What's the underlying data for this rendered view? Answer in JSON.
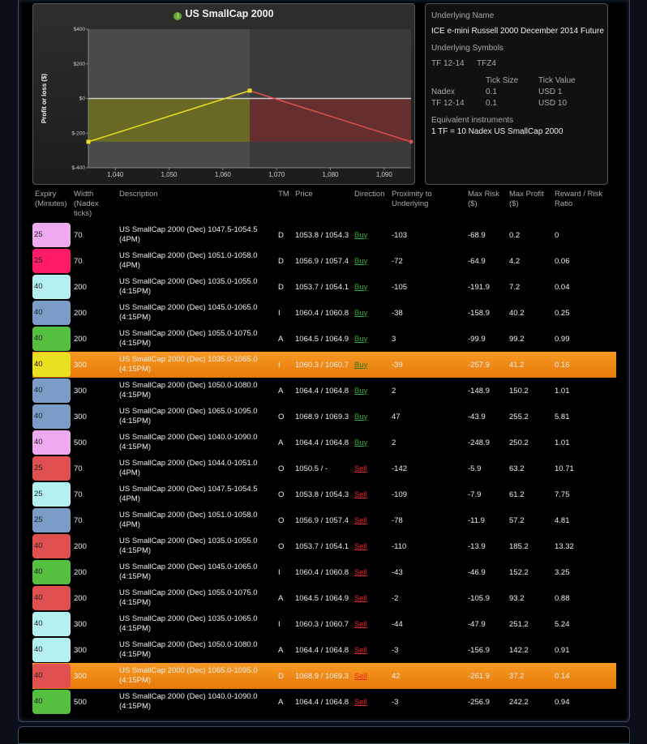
{
  "chart_data": {
    "type": "line",
    "title": "US SmallCap 2000",
    "xlabel": "",
    "ylabel": "Profit or loss ($)",
    "xlim": [
      1035,
      1095
    ],
    "ylim": [
      -400,
      400
    ],
    "x_ticks": [
      "1,040",
      "1,050",
      "1,060",
      "1,070",
      "1,080",
      "1,090"
    ],
    "y_ticks": [
      "$400",
      "$200",
      "$0",
      "$-200",
      "$-400"
    ],
    "grid": false,
    "series": [
      {
        "color": "#e8e020",
        "points": [
          [
            1035,
            -250
          ],
          [
            1065,
            45
          ]
        ]
      },
      {
        "color": "#e05050",
        "points": [
          [
            1065,
            45
          ],
          [
            1095,
            -250
          ]
        ]
      }
    ]
  },
  "info": {
    "underlying_name_label": "Underlying Name",
    "underlying_name": "ICE e-mini Russell 2000 December 2014 Future",
    "underlying_symbols_label": "Underlying Symbols",
    "symbol1": "TF 12-14",
    "symbol2": "TFZ4",
    "tick_size_label": "Tick Size",
    "tick_value_label": "Tick Value",
    "rows": [
      {
        "name": "Nadex",
        "tick_size": "0.1",
        "tick_value": "USD 1"
      },
      {
        "name": "TF 12-14",
        "tick_size": "0.1",
        "tick_value": "USD 10"
      }
    ],
    "equiv_label": "Equivalent instruments",
    "equiv_value": "1 TF = 10 Nadex US SmallCap 2000"
  },
  "table": {
    "headers": {
      "expiry": "Expiry\n(Minutes)",
      "width": "Width\n(Nadex\nticks)",
      "description": "Description",
      "tm": "TM",
      "price": "Price",
      "direction": "Direction",
      "proximity": "Proximity to\nUnderlying",
      "max_risk": "Max Risk\n($)",
      "max_profit": "Max Profit\n($)",
      "reward_risk": "Reward / Risk\nRatio"
    },
    "rows": [
      {
        "expiry": "25",
        "color": "#eeaaee",
        "width": "70",
        "desc": "US SmallCap 2000 (Dec) 1047.5-1054.5 (4PM)",
        "tm": "D",
        "price": "1053.8 / 1054.3",
        "dir": "Buy",
        "prox": "-103",
        "risk": "-68.9",
        "profit": "0.2",
        "ratio": "0",
        "hl": false
      },
      {
        "expiry": "25",
        "color": "#ff1a6a",
        "width": "70",
        "desc": "US SmallCap 2000 (Dec) 1051.0-1058.0 (4PM)",
        "tm": "D",
        "price": "1056.9 / 1057.4",
        "dir": "Buy",
        "prox": "-72",
        "risk": "-64.9",
        "profit": "4.2",
        "ratio": "0.06",
        "hl": false
      },
      {
        "expiry": "40",
        "color": "#b4f0f0",
        "width": "200",
        "desc": "US SmallCap 2000 (Dec) 1035.0-1055.0 (4:15PM)",
        "tm": "D",
        "price": "1053.7 / 1054.1",
        "dir": "Buy",
        "prox": "-105",
        "risk": "-191.9",
        "profit": "7.2",
        "ratio": "0.04",
        "hl": false
      },
      {
        "expiry": "40",
        "color": "#7a9cc6",
        "width": "200",
        "desc": "US SmallCap 2000 (Dec) 1045.0-1065.0 (4:15PM)",
        "tm": "I",
        "price": "1060.4 / 1060.8",
        "dir": "Buy",
        "prox": "-38",
        "risk": "-158.9",
        "profit": "40.2",
        "ratio": "0.25",
        "hl": false
      },
      {
        "expiry": "40",
        "color": "#55c040",
        "width": "200",
        "desc": "US SmallCap 2000 (Dec) 1055.0-1075.0 (4:15PM)",
        "tm": "A",
        "price": "1064.5 / 1064.9",
        "dir": "Buy",
        "prox": "3",
        "risk": "-99.9",
        "profit": "99.2",
        "ratio": "0.99",
        "hl": false
      },
      {
        "expiry": "40",
        "color": "#e8e020",
        "width": "300",
        "desc": "US SmallCap 2000 (Dec) 1035.0-1065.0 (4:15PM)",
        "tm": "I",
        "price": "1060.3 / 1060.7",
        "dir": "Buy",
        "prox": "-39",
        "risk": "-257.9",
        "profit": "41.2",
        "ratio": "0.16",
        "hl": true
      },
      {
        "expiry": "40",
        "color": "#7a9cc6",
        "width": "300",
        "desc": "US SmallCap 2000 (Dec) 1050.0-1080.0 (4:15PM)",
        "tm": "A",
        "price": "1064.4 / 1064.8",
        "dir": "Buy",
        "prox": "2",
        "risk": "-148.9",
        "profit": "150.2",
        "ratio": "1.01",
        "hl": false
      },
      {
        "expiry": "40",
        "color": "#7a9cc6",
        "width": "300",
        "desc": "US SmallCap 2000 (Dec) 1065.0-1095.0 (4:15PM)",
        "tm": "O",
        "price": "1068.9 / 1069.3",
        "dir": "Buy",
        "prox": "47",
        "risk": "-43.9",
        "profit": "255.2",
        "ratio": "5.81",
        "hl": false
      },
      {
        "expiry": "40",
        "color": "#eeaaee",
        "width": "500",
        "desc": "US SmallCap 2000 (Dec) 1040.0-1090.0 (4:15PM)",
        "tm": "A",
        "price": "1064.4 / 1064.8",
        "dir": "Buy",
        "prox": "2",
        "risk": "-248.9",
        "profit": "250.2",
        "ratio": "1.01",
        "hl": false
      },
      {
        "expiry": "25",
        "color": "#e05050",
        "width": "70",
        "desc": "US SmallCap 2000 (Dec) 1044.0-1051.0 (4PM)",
        "tm": "O",
        "price": "1050.5 / -",
        "dir": "Sell",
        "prox": "-142",
        "risk": "-5.9",
        "profit": "63.2",
        "ratio": "10.71",
        "hl": false
      },
      {
        "expiry": "25",
        "color": "#b4f0f0",
        "width": "70",
        "desc": "US SmallCap 2000 (Dec) 1047.5-1054.5 (4PM)",
        "tm": "O",
        "price": "1053.8 / 1054.3",
        "dir": "Sell",
        "prox": "-109",
        "risk": "-7.9",
        "profit": "61.2",
        "ratio": "7.75",
        "hl": false
      },
      {
        "expiry": "25",
        "color": "#7a9cc6",
        "width": "70",
        "desc": "US SmallCap 2000 (Dec) 1051.0-1058.0 (4PM)",
        "tm": "O",
        "price": "1056.9 / 1057.4",
        "dir": "Sell",
        "prox": "-78",
        "risk": "-11.9",
        "profit": "57.2",
        "ratio": "4.81",
        "hl": false
      },
      {
        "expiry": "40",
        "color": "#e05050",
        "width": "200",
        "desc": "US SmallCap 2000 (Dec) 1035.0-1055.0 (4:15PM)",
        "tm": "O",
        "price": "1053.7 / 1054.1",
        "dir": "Sell",
        "prox": "-110",
        "risk": "-13.9",
        "profit": "185.2",
        "ratio": "13.32",
        "hl": false
      },
      {
        "expiry": "40",
        "color": "#55c040",
        "width": "200",
        "desc": "US SmallCap 2000 (Dec) 1045.0-1065.0 (4:15PM)",
        "tm": "I",
        "price": "1060.4 / 1060.8",
        "dir": "Sell",
        "prox": "-43",
        "risk": "-46.9",
        "profit": "152.2",
        "ratio": "3.25",
        "hl": false
      },
      {
        "expiry": "40",
        "color": "#e05050",
        "width": "200",
        "desc": "US SmallCap 2000 (Dec) 1055.0-1075.0 (4:15PM)",
        "tm": "A",
        "price": "1064.5 / 1064.9",
        "dir": "Sell",
        "prox": "-2",
        "risk": "-105.9",
        "profit": "93.2",
        "ratio": "0.88",
        "hl": false
      },
      {
        "expiry": "40",
        "color": "#b4f0f0",
        "width": "300",
        "desc": "US SmallCap 2000 (Dec) 1035.0-1065.0 (4:15PM)",
        "tm": "I",
        "price": "1060.3 / 1060.7",
        "dir": "Sell",
        "prox": "-44",
        "risk": "-47.9",
        "profit": "251.2",
        "ratio": "5.24",
        "hl": false
      },
      {
        "expiry": "40",
        "color": "#b4f0f0",
        "width": "300",
        "desc": "US SmallCap 2000 (Dec) 1050.0-1080.0 (4:15PM)",
        "tm": "A",
        "price": "1064.4 / 1064.8",
        "dir": "Sell",
        "prox": "-3",
        "risk": "-156.9",
        "profit": "142.2",
        "ratio": "0.91",
        "hl": false
      },
      {
        "expiry": "40",
        "color": "#e05050",
        "width": "300",
        "desc": "US SmallCap 2000 (Dec) 1065.0-1095.0 (4:15PM)",
        "tm": "D",
        "price": "1068.9 / 1069.3",
        "dir": "Sell",
        "prox": "42",
        "risk": "-261.9",
        "profit": "37.2",
        "ratio": "0.14",
        "hl": true
      },
      {
        "expiry": "40",
        "color": "#55c040",
        "width": "500",
        "desc": "US SmallCap 2000 (Dec) 1040.0-1090.0 (4:15PM)",
        "tm": "A",
        "price": "1064.4 / 1064.8",
        "dir": "Sell",
        "prox": "-3",
        "risk": "-256.9",
        "profit": "242.2",
        "ratio": "0.94",
        "hl": false
      }
    ]
  }
}
